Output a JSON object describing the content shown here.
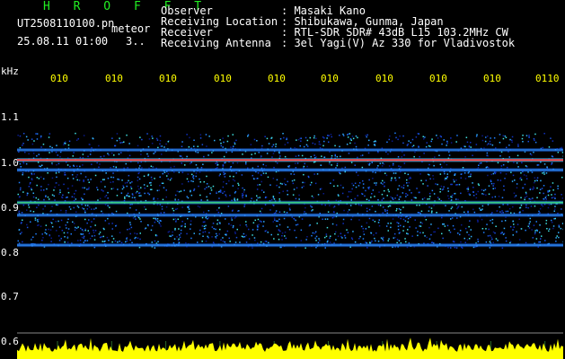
{
  "header": {
    "title": "H R O F F T",
    "filename": "UT2508110100.pn",
    "file_tag": "meteor",
    "datetime": "25.08.11 01:00",
    "extra": "3..",
    "labels": [
      "Observer",
      "Receiving Location",
      "Receiver",
      "Receiving Antenna"
    ],
    "values": [
      ": Masaki Kano",
      ": Shibukawa, Gunma, Japan",
      ": RTL-SDR SDR# 43dB L15 103.2MHz CW",
      ": 3el Yagi(V) Az 330 for Vladivostok"
    ]
  },
  "colors": {
    "background": "#000000",
    "text": "#ffffff",
    "title": "#22ee22",
    "ticks": "#ffff00",
    "meteor_band": "#ff4040",
    "level": "#ffff00"
  },
  "chart_data": {
    "type": "heatmap",
    "ylabel": "kHz",
    "yticks": [
      "1.1",
      "1.0",
      "0.9",
      "0.8",
      "0.7",
      "0.6"
    ],
    "ylim": [
      0.6,
      1.15
    ],
    "xticks": [
      "010",
      "010",
      "010",
      "010",
      "010",
      "010",
      "010",
      "010",
      "010",
      "0110"
    ],
    "bands": [
      {
        "freq_khz": 0.985,
        "intensity": 0.35
      },
      {
        "freq_khz": 0.965,
        "intensity": 1.0
      },
      {
        "freq_khz": 0.945,
        "intensity": 0.55
      },
      {
        "freq_khz": 0.88,
        "intensity": 0.7
      },
      {
        "freq_khz": 0.855,
        "intensity": 0.45
      },
      {
        "freq_khz": 0.795,
        "intensity": 0.5
      }
    ],
    "noise_range_khz": [
      0.79,
      1.02
    ],
    "level_strip": "yellow signal level trace"
  }
}
